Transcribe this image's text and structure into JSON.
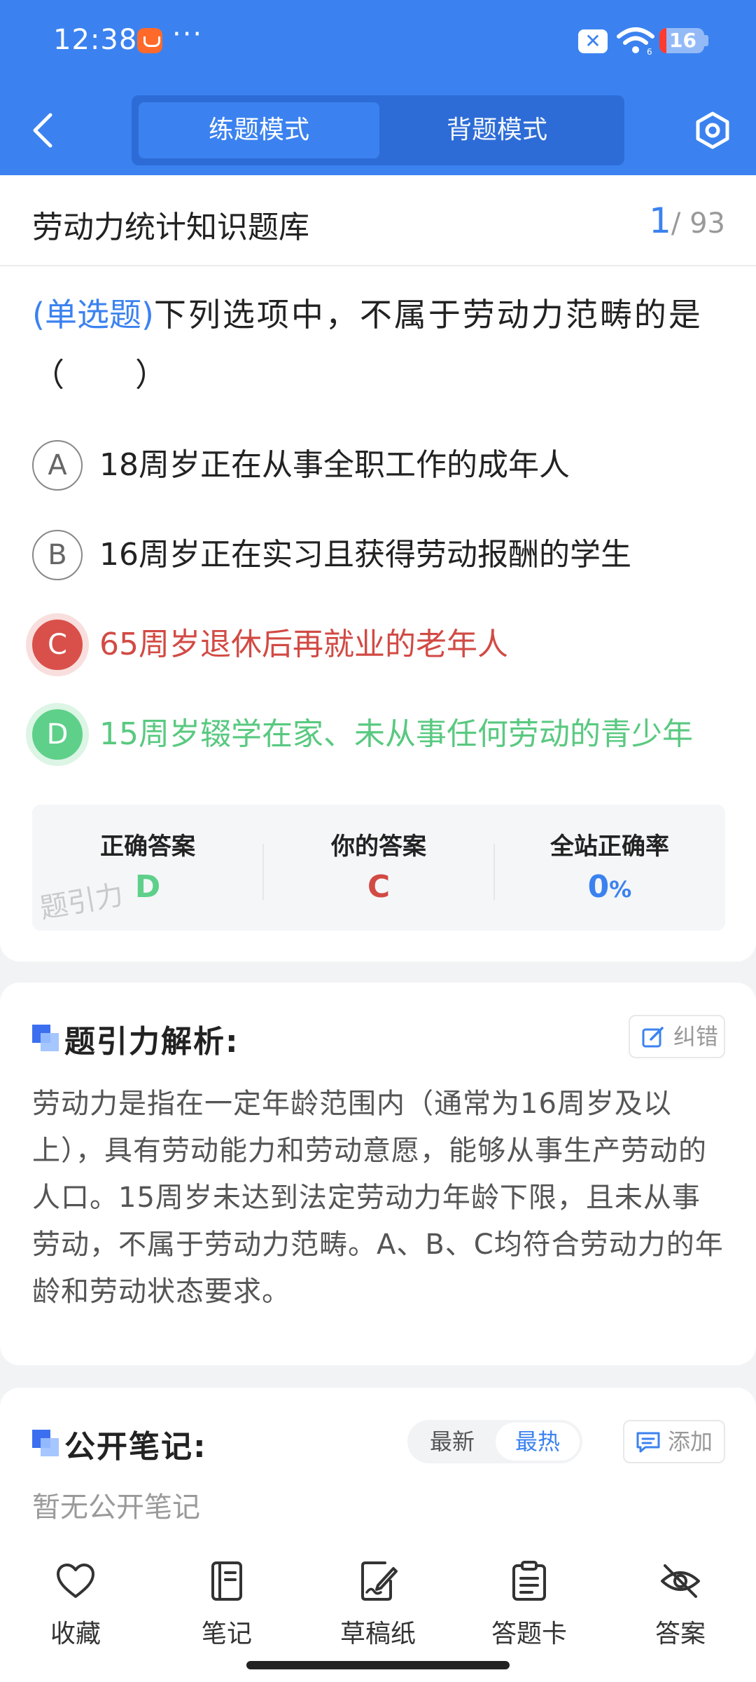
{
  "status_bar": {
    "time": "12:38",
    "dots": "···",
    "battery": "16"
  },
  "header": {
    "modes": [
      "练题模式",
      "背题模式"
    ],
    "active_mode": "练题模式"
  },
  "bank": {
    "title": "劳动力统计知识题库",
    "current": "1",
    "total": "/ 93"
  },
  "question": {
    "type_label": "(单选题)",
    "text": "下列选项中，不属于劳动力范畴的是（　　）"
  },
  "options": [
    {
      "letter": "A",
      "text": "18周岁正在从事全职工作的成年人",
      "state": "normal"
    },
    {
      "letter": "B",
      "text": "16周岁正在实习且获得劳动报酬的学生",
      "state": "normal"
    },
    {
      "letter": "C",
      "text": "65周岁退休后再就业的老年人",
      "state": "wrong"
    },
    {
      "letter": "D",
      "text": "15周岁辍学在家、未从事任何劳动的青少年",
      "state": "correct"
    }
  ],
  "answer_summary": {
    "correct_label": "正确答案",
    "correct_value": "D",
    "yours_label": "你的答案",
    "yours_value": "C",
    "rate_label": "全站正确率",
    "rate_value": "0",
    "rate_unit": "%",
    "watermark": "题引力"
  },
  "analysis": {
    "title": "题引力解析:",
    "report_label": "纠错",
    "text": "劳动力是指在一定年龄范围内（通常为16周岁及以上），具有劳动能力和劳动意愿，能够从事生产劳动的人口。15周岁未达到法定劳动力年龄下限，且未从事劳动，不属于劳动力范畴。A、B、C均符合劳动力的年龄和劳动状态要求。"
  },
  "notes": {
    "title": "公开笔记:",
    "sort_new": "最新",
    "sort_hot": "最热",
    "add_label": "添加",
    "empty_text": "暂无公开笔记"
  },
  "bottom_nav": [
    {
      "label": "收藏",
      "icon": "heart-icon"
    },
    {
      "label": "笔记",
      "icon": "notebook-icon"
    },
    {
      "label": "草稿纸",
      "icon": "draft-icon"
    },
    {
      "label": "答题卡",
      "icon": "clipboard-icon"
    },
    {
      "label": "答案",
      "icon": "eye-off-icon"
    }
  ],
  "colors": {
    "brand": "#3b82f0",
    "wrong": "#d9504a",
    "correct": "#5ed08a"
  }
}
